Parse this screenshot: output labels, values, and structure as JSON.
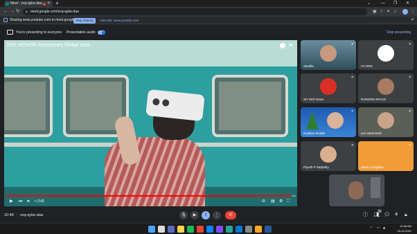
{
  "browser": {
    "tab_title": "Meet - zvq-qyke-daa",
    "new_tab": "+",
    "url": "meet.google.com/zvq-qyke-daa",
    "window_controls": [
      "⌄",
      "—",
      "❐",
      "✕"
    ]
  },
  "share_bar": {
    "message": "Sharing www.youtube.com to meet.google.com",
    "stop_label": "Stop sharing",
    "view_label": "View tab: www.youtube.com"
  },
  "presenting_bar": {
    "text": "You're presenting to everyone",
    "audio_label": "Presentation audio",
    "audio_on": true,
    "stop_label": "Stop presenting"
  },
  "video": {
    "title": "2021 HONOR Anniversary Global Gals",
    "live_label": "• LIVE",
    "progress": 0.985
  },
  "participants": [
    {
      "name": "Zanella",
      "style": "photo",
      "muted": true
    },
    {
      "name": "I'm RRS",
      "style": "avatar",
      "muted": true
    },
    {
      "name": "SH Tech News",
      "style": "avatar-red",
      "muted": true
    },
    {
      "name": "RANDOM SPACE",
      "style": "avatar",
      "muted": true
    },
    {
      "name": "Krystian Motala",
      "style": "xmas",
      "muted": true
    },
    {
      "name": "Leo Hammond",
      "style": "photo",
      "muted": true
    },
    {
      "name": "Piyush P Satpathy",
      "style": "avatar",
      "muted": true
    },
    {
      "name": "Martin Coughlan",
      "style": "orange",
      "muted": true
    }
  ],
  "meeting": {
    "time": "10:48",
    "separator": "|",
    "code": "zvq-qyke-daa",
    "people_count": "10"
  },
  "taskbar": {
    "time": "10:48 AM",
    "date": "16-12-2021"
  },
  "colors": {
    "accent": "#8ab4f8",
    "end_call": "#ea4335",
    "youtube_red": "#ff0000"
  }
}
